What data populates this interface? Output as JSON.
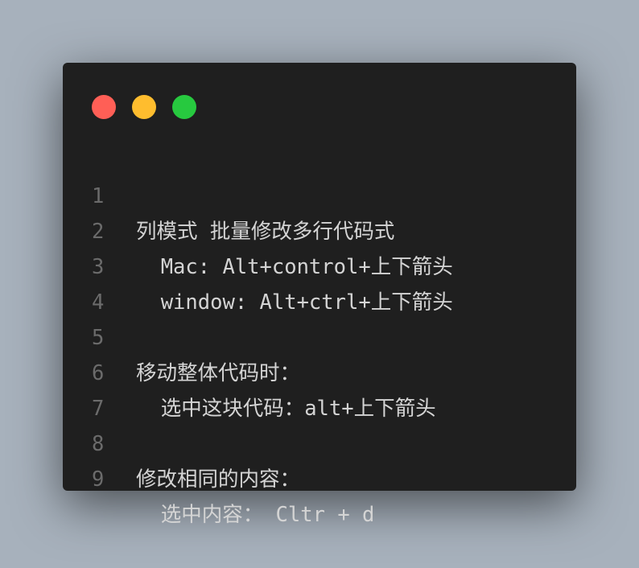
{
  "window": {
    "controls": {
      "close_color": "#ff5f56",
      "minimize_color": "#ffbd2e",
      "zoom_color": "#27c93f"
    },
    "lines": [
      {
        "number": "1",
        "text": "列模式 批量修改多行代码式"
      },
      {
        "number": "2",
        "text": "  Mac: Alt+control+上下箭头"
      },
      {
        "number": "3",
        "text": "  window: Alt+ctrl+上下箭头"
      },
      {
        "number": "4",
        "text": ""
      },
      {
        "number": "5",
        "text": "移动整体代码时："
      },
      {
        "number": "6",
        "text": "  选中这块代码：alt+上下箭头"
      },
      {
        "number": "7",
        "text": ""
      },
      {
        "number": "8",
        "text": "修改相同的内容："
      },
      {
        "number": "9",
        "text": "  选中内容： Cltr + d"
      }
    ]
  }
}
